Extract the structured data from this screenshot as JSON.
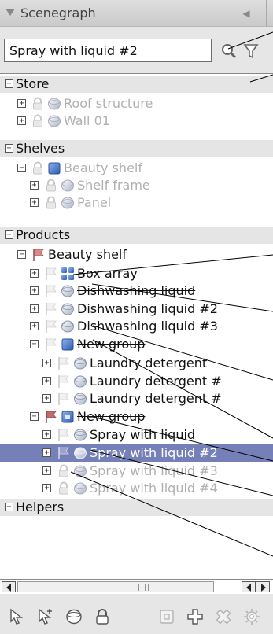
{
  "panel": {
    "title": "Scenegraph",
    "dock_glyph": "◀",
    "search": {
      "value": "Spray with liquid #2",
      "placeholder": ""
    },
    "icons": {
      "search": "search-icon",
      "filter": "filter-icon"
    }
  },
  "tree": {
    "store": {
      "label": "Store",
      "roof_structure": "Roof structure",
      "wall_01": "Wall 01"
    },
    "shelves": {
      "label": "Shelves",
      "beauty_shelf": "Beauty shelf",
      "shelf_frame": "Shelf frame",
      "panel": "Panel"
    },
    "products": {
      "label": "Products",
      "beauty_shelf": "Beauty shelf",
      "box_array": "Box array",
      "dishwashing_liquid": "Dishwashing liquid",
      "dishwashing_liquid_2": "Dishwashing liquid #2",
      "dishwashing_liquid_3": "Dishwashing liquid #3",
      "new_group_1": "New group",
      "laundry_detergent": "Laundry detergent",
      "laundry_detergent_2": "Laundry detergent #",
      "laundry_detergent_3": "Laundry detergent #",
      "new_group_2": "New group",
      "spray_1": "Spray with liquid",
      "spray_2": "Spray with liquid #2",
      "spray_3": "Spray with liquid #3",
      "spray_4": "Spray with liquid #4"
    },
    "helpers": {
      "label": "Helpers"
    }
  },
  "scrollbar": {
    "grip": "||||"
  },
  "toolbar": {
    "buttons": [
      "select-icon",
      "select-add-icon",
      "object-icon",
      "lock-icon",
      "group-icon",
      "add-icon",
      "delete-icon",
      "settings-icon"
    ]
  },
  "colors": {
    "selection": "#7680b8",
    "category_bg": "#e5e5e5",
    "dim_text": "#b0b0b0",
    "flag_red": "#c06a6a",
    "accent_blue": "#4a78c0"
  }
}
